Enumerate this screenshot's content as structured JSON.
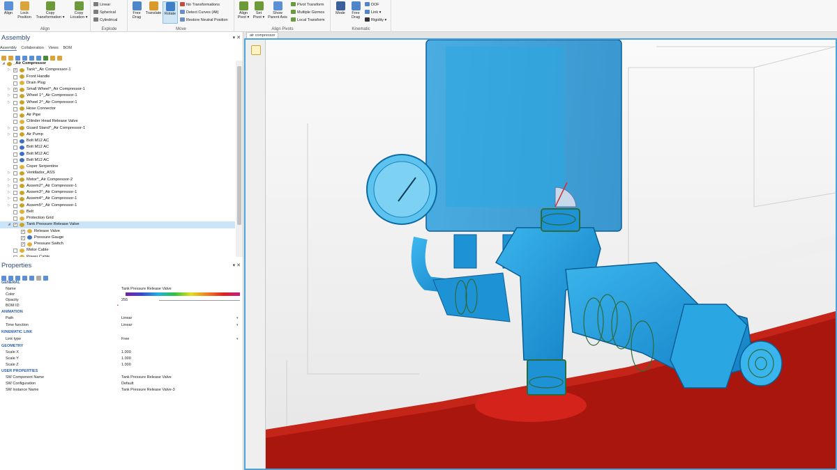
{
  "ribbon": {
    "groups": [
      {
        "label": "Align"
      },
      {
        "label": "Explode"
      },
      {
        "label": "Move"
      },
      {
        "label": "Align Pivots"
      },
      {
        "label": "Kinematic"
      }
    ],
    "buttons": {
      "align": "Align",
      "lock_position": "Lock Position",
      "copy_transformation": "Copy Transformation ▾",
      "copy_location": "Copy Location ▾",
      "linear": "Linear",
      "spherical": "Spherical",
      "cylindrical": "Cylindrical",
      "free_drag": "Free Drag",
      "translate": "Translate",
      "rotate": "Rotate",
      "no_transformations": "No Transformations",
      "detect_curves": "Detect Curves (Alt)",
      "restore_neutral": "Restore Neutral Position",
      "align_pivot": "Align Pivot ▾",
      "set_pivot": "Set Pivot ▾",
      "show_parent_axis": "Show Parent Axis",
      "pivot_transform": "Pivot Transform",
      "multiple_gizmos": "Multiple Gizmos",
      "local_transform": "Local Transform",
      "mode": "Mode",
      "kin_free_drag": "Free Drag",
      "dof": "DOF",
      "link": "Link ▾",
      "rigidity": "Rigidity ▾"
    }
  },
  "assembly": {
    "title": "Assembly",
    "tabs": [
      "Assembly",
      "Collaboration",
      "Views",
      "BOM"
    ],
    "root": "_Air Compressor",
    "items": [
      {
        "label": "Tank^_Air Compressor-1",
        "level": 1,
        "exp": "▷",
        "chk": "✓",
        "color": "#c9a227"
      },
      {
        "label": "Front Handle",
        "level": 1,
        "exp": "",
        "chk": "",
        "color": "#c9a227"
      },
      {
        "label": "Drain Plug",
        "level": 1,
        "exp": "",
        "chk": "",
        "color": "#e0b13a"
      },
      {
        "label": "Small Wheel^_Air Compressor-1",
        "level": 1,
        "exp": "▷",
        "chk": "✓",
        "color": "#c9a227"
      },
      {
        "label": "Wheel 1^_Air Compressor-1",
        "level": 1,
        "exp": "▷",
        "chk": "",
        "color": "#c9a227"
      },
      {
        "label": "Wheel 2^_Air Compressor-1",
        "level": 1,
        "exp": "▷",
        "chk": "",
        "color": "#c9a227"
      },
      {
        "label": "Hose Connector",
        "level": 1,
        "exp": "",
        "chk": "",
        "color": "#c9a227"
      },
      {
        "label": "Air Pipe",
        "level": 1,
        "exp": "",
        "chk": "",
        "color": "#c9a227"
      },
      {
        "label": "Cilinder Head Release Valve",
        "level": 1,
        "exp": "",
        "chk": "",
        "color": "#e0b13a"
      },
      {
        "label": "Guard Stand^_Air Compressor-1",
        "level": 1,
        "exp": "▷",
        "chk": "",
        "color": "#c9a227"
      },
      {
        "label": "Air Pump",
        "level": 1,
        "exp": "▷",
        "chk": "",
        "color": "#c9a227"
      },
      {
        "label": "Bolt M12 AC",
        "level": 1,
        "exp": "",
        "chk": "",
        "color": "#3a6fc4"
      },
      {
        "label": "Bolt M12 AC",
        "level": 1,
        "exp": "",
        "chk": "",
        "color": "#3a6fc4"
      },
      {
        "label": "Bolt M12 AC",
        "level": 1,
        "exp": "",
        "chk": "",
        "color": "#3a6fc4"
      },
      {
        "label": "Bolt M12 AC",
        "level": 1,
        "exp": "",
        "chk": "",
        "color": "#3a6fc4"
      },
      {
        "label": "Coper Serpentine",
        "level": 1,
        "exp": "",
        "chk": "",
        "color": "#e0b13a"
      },
      {
        "label": "Ventilador_ASS",
        "level": 1,
        "exp": "▷",
        "chk": "",
        "color": "#c9a227"
      },
      {
        "label": "Motor^_Air Compressor-2",
        "level": 1,
        "exp": "▷",
        "chk": "",
        "color": "#c9a227"
      },
      {
        "label": "Assem2^_Air Compressor-1",
        "level": 1,
        "exp": "▷",
        "chk": "",
        "color": "#c9a227"
      },
      {
        "label": "Assem3^_Air Compressor-1",
        "level": 1,
        "exp": "▷",
        "chk": "",
        "color": "#c9a227"
      },
      {
        "label": "Assem4^_Air Compressor-1",
        "level": 1,
        "exp": "▷",
        "chk": "",
        "color": "#c9a227"
      },
      {
        "label": "Assem5^_Air Compressor-1",
        "level": 1,
        "exp": "▷",
        "chk": "",
        "color": "#c9a227"
      },
      {
        "label": "Belt",
        "level": 1,
        "exp": "",
        "chk": "",
        "color": "#e0b13a"
      },
      {
        "label": "Protection Grid",
        "level": 1,
        "exp": "",
        "chk": "",
        "color": "#e0b13a"
      },
      {
        "label": "Tank Pressure Release Valve",
        "level": 1,
        "exp": "◢",
        "chk": "✓",
        "color": "#c9a227",
        "selected": true
      },
      {
        "label": "Release Valve",
        "level": 2,
        "exp": "",
        "chk": "✓",
        "color": "#e0b13a"
      },
      {
        "label": "Pressure Gauge",
        "level": 2,
        "exp": "",
        "chk": "✓",
        "color": "#3a6fc4"
      },
      {
        "label": "Pressure Switch",
        "level": 2,
        "exp": "",
        "chk": "✓",
        "color": "#e0b13a"
      },
      {
        "label": "Motor Cable",
        "level": 1,
        "exp": "",
        "chk": "",
        "color": "#e0b13a"
      },
      {
        "label": "Power Cable",
        "level": 1,
        "exp": "",
        "chk": "",
        "color": "#e0b13a"
      }
    ]
  },
  "properties": {
    "title": "Properties",
    "sections": {
      "general": "GENERAL",
      "animation": "ANIMATION",
      "kinematic_link": "KINEMATIC LINK",
      "geometry": "GEOMETRY",
      "user_properties": "USER PROPERTIES"
    },
    "rows": {
      "name_label": "Name",
      "name_value": "Tank Pressure Release Valve",
      "color_label": "Color",
      "opacity_label": "Opacity",
      "opacity_value": "255",
      "bomid_label": "BOM ID",
      "path_label": "Path",
      "path_value": "Linear",
      "timefn_label": "Time function",
      "timefn_value": "Linear",
      "linktype_label": "Link type",
      "linktype_value": "Free",
      "scalex_label": "Scale X",
      "scalex_value": "1.000",
      "scaley_label": "Scale Y",
      "scaley_value": "1.000",
      "scalez_label": "Scale Z",
      "scalez_value": "1.000",
      "swcomp_label": "SW Component Name",
      "swcomp_value": "Tank Pressure Release Valve",
      "swconf_label": "SW Configuration",
      "swconf_value": "Default",
      "swinst_label": "SW Instance Name",
      "swinst_value": "Tank Pressure Release Valve-3"
    }
  },
  "viewport": {
    "tab": "air compressor"
  },
  "colors": {
    "accent": "#4aa3df",
    "selection": "#cce4f7",
    "part_blue": "#1e9fe0",
    "floor_red": "#b01a10"
  }
}
